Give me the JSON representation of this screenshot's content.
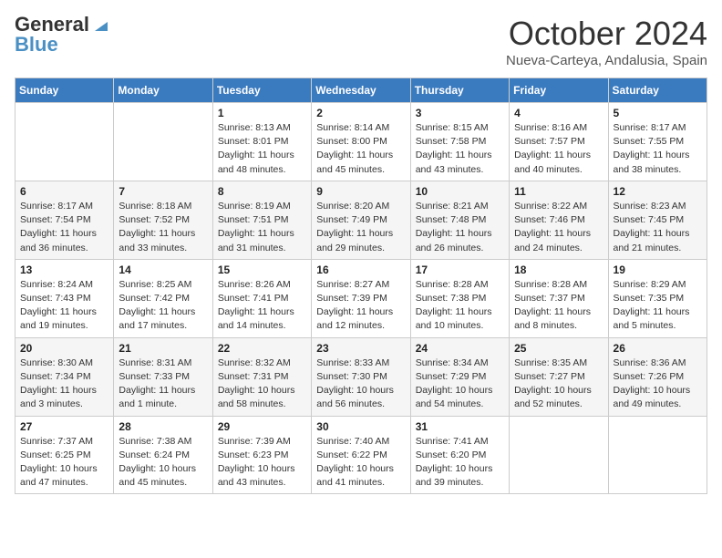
{
  "header": {
    "logo_general": "General",
    "logo_blue": "Blue",
    "month": "October 2024",
    "location": "Nueva-Carteya, Andalusia, Spain"
  },
  "weekdays": [
    "Sunday",
    "Monday",
    "Tuesday",
    "Wednesday",
    "Thursday",
    "Friday",
    "Saturday"
  ],
  "weeks": [
    [
      {
        "day": "",
        "info": ""
      },
      {
        "day": "",
        "info": ""
      },
      {
        "day": "1",
        "info": "Sunrise: 8:13 AM\nSunset: 8:01 PM\nDaylight: 11 hours and 48 minutes."
      },
      {
        "day": "2",
        "info": "Sunrise: 8:14 AM\nSunset: 8:00 PM\nDaylight: 11 hours and 45 minutes."
      },
      {
        "day": "3",
        "info": "Sunrise: 8:15 AM\nSunset: 7:58 PM\nDaylight: 11 hours and 43 minutes."
      },
      {
        "day": "4",
        "info": "Sunrise: 8:16 AM\nSunset: 7:57 PM\nDaylight: 11 hours and 40 minutes."
      },
      {
        "day": "5",
        "info": "Sunrise: 8:17 AM\nSunset: 7:55 PM\nDaylight: 11 hours and 38 minutes."
      }
    ],
    [
      {
        "day": "6",
        "info": "Sunrise: 8:17 AM\nSunset: 7:54 PM\nDaylight: 11 hours and 36 minutes."
      },
      {
        "day": "7",
        "info": "Sunrise: 8:18 AM\nSunset: 7:52 PM\nDaylight: 11 hours and 33 minutes."
      },
      {
        "day": "8",
        "info": "Sunrise: 8:19 AM\nSunset: 7:51 PM\nDaylight: 11 hours and 31 minutes."
      },
      {
        "day": "9",
        "info": "Sunrise: 8:20 AM\nSunset: 7:49 PM\nDaylight: 11 hours and 29 minutes."
      },
      {
        "day": "10",
        "info": "Sunrise: 8:21 AM\nSunset: 7:48 PM\nDaylight: 11 hours and 26 minutes."
      },
      {
        "day": "11",
        "info": "Sunrise: 8:22 AM\nSunset: 7:46 PM\nDaylight: 11 hours and 24 minutes."
      },
      {
        "day": "12",
        "info": "Sunrise: 8:23 AM\nSunset: 7:45 PM\nDaylight: 11 hours and 21 minutes."
      }
    ],
    [
      {
        "day": "13",
        "info": "Sunrise: 8:24 AM\nSunset: 7:43 PM\nDaylight: 11 hours and 19 minutes."
      },
      {
        "day": "14",
        "info": "Sunrise: 8:25 AM\nSunset: 7:42 PM\nDaylight: 11 hours and 17 minutes."
      },
      {
        "day": "15",
        "info": "Sunrise: 8:26 AM\nSunset: 7:41 PM\nDaylight: 11 hours and 14 minutes."
      },
      {
        "day": "16",
        "info": "Sunrise: 8:27 AM\nSunset: 7:39 PM\nDaylight: 11 hours and 12 minutes."
      },
      {
        "day": "17",
        "info": "Sunrise: 8:28 AM\nSunset: 7:38 PM\nDaylight: 11 hours and 10 minutes."
      },
      {
        "day": "18",
        "info": "Sunrise: 8:28 AM\nSunset: 7:37 PM\nDaylight: 11 hours and 8 minutes."
      },
      {
        "day": "19",
        "info": "Sunrise: 8:29 AM\nSunset: 7:35 PM\nDaylight: 11 hours and 5 minutes."
      }
    ],
    [
      {
        "day": "20",
        "info": "Sunrise: 8:30 AM\nSunset: 7:34 PM\nDaylight: 11 hours and 3 minutes."
      },
      {
        "day": "21",
        "info": "Sunrise: 8:31 AM\nSunset: 7:33 PM\nDaylight: 11 hours and 1 minute."
      },
      {
        "day": "22",
        "info": "Sunrise: 8:32 AM\nSunset: 7:31 PM\nDaylight: 10 hours and 58 minutes."
      },
      {
        "day": "23",
        "info": "Sunrise: 8:33 AM\nSunset: 7:30 PM\nDaylight: 10 hours and 56 minutes."
      },
      {
        "day": "24",
        "info": "Sunrise: 8:34 AM\nSunset: 7:29 PM\nDaylight: 10 hours and 54 minutes."
      },
      {
        "day": "25",
        "info": "Sunrise: 8:35 AM\nSunset: 7:27 PM\nDaylight: 10 hours and 52 minutes."
      },
      {
        "day": "26",
        "info": "Sunrise: 8:36 AM\nSunset: 7:26 PM\nDaylight: 10 hours and 49 minutes."
      }
    ],
    [
      {
        "day": "27",
        "info": "Sunrise: 7:37 AM\nSunset: 6:25 PM\nDaylight: 10 hours and 47 minutes."
      },
      {
        "day": "28",
        "info": "Sunrise: 7:38 AM\nSunset: 6:24 PM\nDaylight: 10 hours and 45 minutes."
      },
      {
        "day": "29",
        "info": "Sunrise: 7:39 AM\nSunset: 6:23 PM\nDaylight: 10 hours and 43 minutes."
      },
      {
        "day": "30",
        "info": "Sunrise: 7:40 AM\nSunset: 6:22 PM\nDaylight: 10 hours and 41 minutes."
      },
      {
        "day": "31",
        "info": "Sunrise: 7:41 AM\nSunset: 6:20 PM\nDaylight: 10 hours and 39 minutes."
      },
      {
        "day": "",
        "info": ""
      },
      {
        "day": "",
        "info": ""
      }
    ]
  ]
}
